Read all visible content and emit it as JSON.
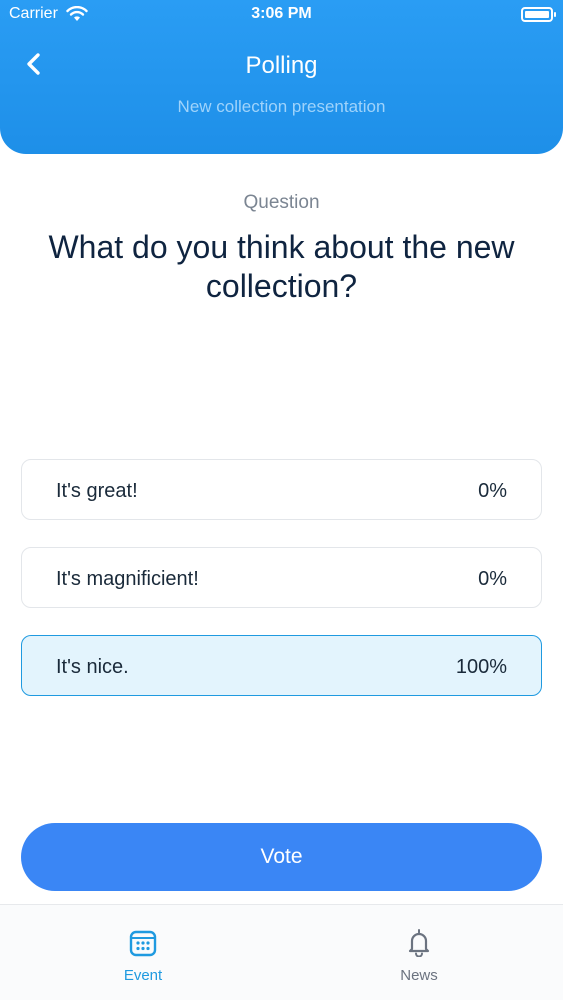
{
  "status_bar": {
    "carrier": "Carrier",
    "time": "3:06 PM"
  },
  "header": {
    "title": "Polling",
    "subtitle": "New collection presentation",
    "back_icon": "chevron-left-icon"
  },
  "question": {
    "label": "Question",
    "text": "What do you think about the new collection?"
  },
  "options": [
    {
      "label": "It's great!",
      "percent": "0%",
      "selected": false
    },
    {
      "label": "It's magnificient!",
      "percent": "0%",
      "selected": false
    },
    {
      "label": "It's nice.",
      "percent": "100%",
      "selected": true
    }
  ],
  "vote_button": {
    "label": "Vote"
  },
  "tab_bar": {
    "tabs": [
      {
        "label": "Event",
        "icon": "calendar-icon",
        "active": true
      },
      {
        "label": "News",
        "icon": "bell-icon",
        "active": false
      }
    ]
  },
  "colors": {
    "header_bg": "#2a9df4",
    "accent": "#1f9ae0",
    "vote_button": "#3a86f5",
    "selected_option_bg": "#e3f4fd",
    "text_dark": "#0f2440"
  }
}
